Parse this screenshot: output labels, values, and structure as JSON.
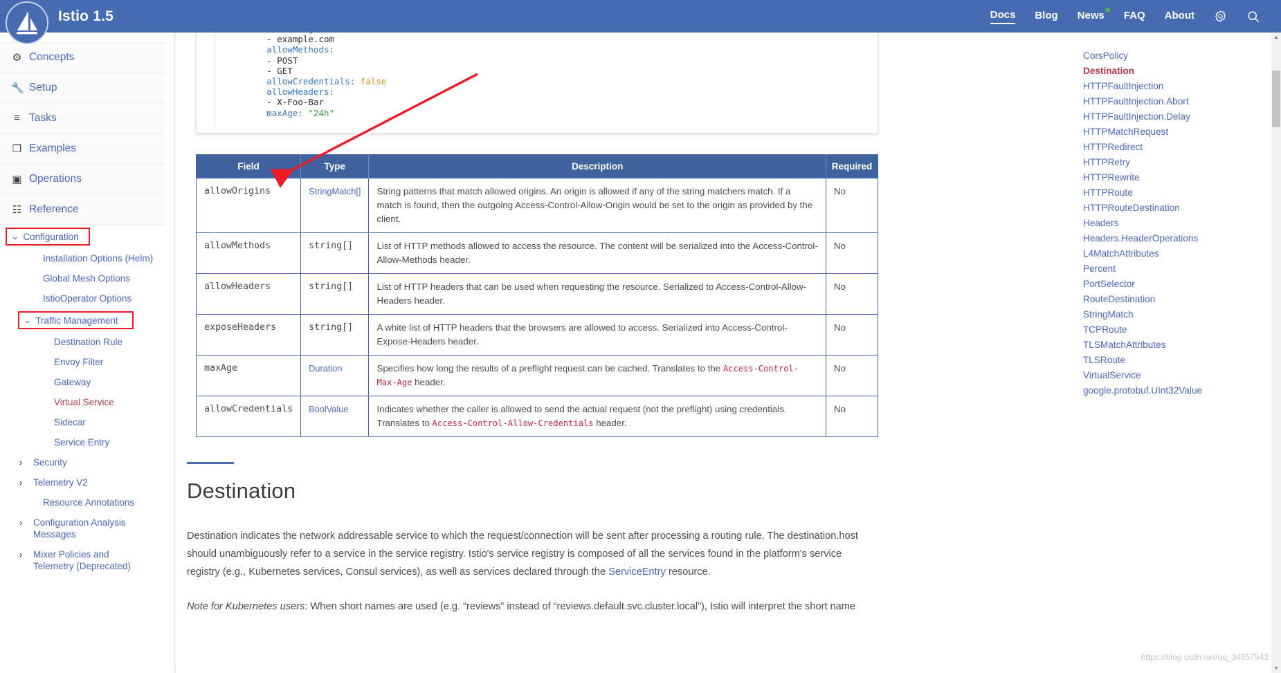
{
  "header": {
    "brand_title": "Istio 1.5",
    "logo_icon": "istio-sail-logo",
    "nav": [
      {
        "label": "Docs",
        "active": true,
        "dot": false
      },
      {
        "label": "Blog",
        "active": false,
        "dot": false
      },
      {
        "label": "News",
        "active": false,
        "dot": true
      },
      {
        "label": "FAQ",
        "active": false,
        "dot": false
      },
      {
        "label": "About",
        "active": false,
        "dot": false
      }
    ],
    "gear_icon": "gear-icon",
    "search_icon": "search-icon",
    "bg_color": "#466bb0"
  },
  "sidebar": {
    "major": [
      {
        "label": "Concepts",
        "icon": "lightbulb-icon"
      },
      {
        "label": "Setup",
        "icon": "wrench-icon"
      },
      {
        "label": "Tasks",
        "icon": "list-icon"
      },
      {
        "label": "Examples",
        "icon": "copy-icon"
      },
      {
        "label": "Operations",
        "icon": "clipboard-icon"
      },
      {
        "label": "Reference",
        "icon": "book-icon"
      }
    ],
    "configuration": {
      "label": "Configuration",
      "highlighted": true,
      "expanded": true
    },
    "config_children": [
      {
        "label": "Installation Options (Helm)"
      },
      {
        "label": "Global Mesh Options"
      },
      {
        "label": "IstioOperator Options"
      }
    ],
    "traffic_management": {
      "label": "Traffic Management",
      "highlighted": true,
      "expanded": true
    },
    "traffic_children": [
      {
        "label": "Destination Rule",
        "current": false
      },
      {
        "label": "Envoy Filter",
        "current": false
      },
      {
        "label": "Gateway",
        "current": false
      },
      {
        "label": "Virtual Service",
        "current": true
      },
      {
        "label": "Sidecar",
        "current": false
      },
      {
        "label": "Service Entry",
        "current": false
      }
    ],
    "collapsed_groups": [
      {
        "label": "Security"
      },
      {
        "label": "Telemetry V2"
      }
    ],
    "tail": [
      {
        "label": "Resource Annotations",
        "chevron": false
      },
      {
        "label": "Configuration Analysis Messages",
        "chevron": true
      },
      {
        "label": "Mixer Policies and Telemetry (Deprecated)",
        "chevron": true
      }
    ]
  },
  "code_block": {
    "lines": [
      {
        "segments": [
          {
            "t": "        allowOrigins:",
            "c": "tok-key"
          }
        ]
      },
      {
        "segments": [
          {
            "t": "        - example.com",
            "c": "tok-plain"
          }
        ]
      },
      {
        "segments": [
          {
            "t": "        allowMethods:",
            "c": "tok-key"
          }
        ]
      },
      {
        "segments": [
          {
            "t": "        - POST",
            "c": "tok-plain"
          }
        ]
      },
      {
        "segments": [
          {
            "t": "        - GET",
            "c": "tok-plain"
          }
        ]
      },
      {
        "segments": [
          {
            "t": "        allowCredentials: ",
            "c": "tok-key"
          },
          {
            "t": "false",
            "c": "tok-val"
          }
        ]
      },
      {
        "segments": [
          {
            "t": "        allowHeaders:",
            "c": "tok-key"
          }
        ]
      },
      {
        "segments": [
          {
            "t": "        - X-Foo-Bar",
            "c": "tok-plain"
          }
        ]
      },
      {
        "segments": [
          {
            "t": "        maxAge: ",
            "c": "tok-key"
          },
          {
            "t": "\"24h\"",
            "c": "tok-str"
          }
        ]
      }
    ]
  },
  "table": {
    "headers": [
      "Field",
      "Type",
      "Description",
      "Required"
    ],
    "rows": [
      {
        "field": "allowOrigins",
        "type": "StringMatch[]",
        "type_is_link": true,
        "description_html": "String patterns that match allowed origins. An origin is allowed if any of the string matchers match. If a match is found, then the outgoing Access-Control-Allow-Origin would be set to the origin as provided by the client.",
        "required": "No"
      },
      {
        "field": "allowMethods",
        "type": "string[]",
        "type_is_link": false,
        "description_html": "List of HTTP methods allowed to access the resource. The content will be serialized into the Access-Control-Allow-Methods header.",
        "required": "No"
      },
      {
        "field": "allowHeaders",
        "type": "string[]",
        "type_is_link": false,
        "description_html": "List of HTTP headers that can be used when requesting the resource. Serialized to Access-Control-Allow-Headers header.",
        "required": "No"
      },
      {
        "field": "exposeHeaders",
        "type": "string[]",
        "type_is_link": false,
        "description_html": "A white list of HTTP headers that the browsers are allowed to access. Serialized into Access-Control-Expose-Headers header.",
        "required": "No"
      },
      {
        "field": "maxAge",
        "type": "Duration",
        "type_is_link": true,
        "description_html": "Specifies how long the results of a preflight request can be cached. Translates to the <code class=\"inl\">Access-Control-Max-Age</code> header.",
        "required": "No"
      },
      {
        "field": "allowCredentials",
        "type": "BoolValue",
        "type_is_link": true,
        "description_html": "Indicates whether the caller is allowed to send the actual request (not the preflight) using credentials. Translates to <code class=\"inl\">Access-Control-Allow-Credentials</code> header.",
        "required": "No"
      }
    ]
  },
  "destination": {
    "title": "Destination",
    "paragraph1_before": "Destination indicates the network addressable service to which the request/connection will be sent after processing a routing rule. The destination.host should unambiguously refer to a service in the service registry. Istio's service registry is composed of all the services found in the platform's service registry (e.g., Kubernetes services, Consul services), as well as services declared through the ",
    "paragraph1_link": "ServiceEntry",
    "paragraph1_after": " resource.",
    "note_italic": "Note for Kubernetes users",
    "note_rest": ": When short names are used (e.g. “reviews” instead of “reviews.default.svc.cluster.local”), Istio will interpret the short name"
  },
  "toc": {
    "items": [
      {
        "label": "CorsPolicy",
        "current": false
      },
      {
        "label": "Destination",
        "current": true
      },
      {
        "label": "HTTPFaultInjection",
        "current": false
      },
      {
        "label": "HTTPFaultInjection.Abort",
        "current": false
      },
      {
        "label": "HTTPFaultInjection.Delay",
        "current": false
      },
      {
        "label": "HTTPMatchRequest",
        "current": false
      },
      {
        "label": "HTTPRedirect",
        "current": false
      },
      {
        "label": "HTTPRetry",
        "current": false
      },
      {
        "label": "HTTPRewrite",
        "current": false
      },
      {
        "label": "HTTPRoute",
        "current": false
      },
      {
        "label": "HTTPRouteDestination",
        "current": false
      },
      {
        "label": "Headers",
        "current": false
      },
      {
        "label": "Headers.HeaderOperations",
        "current": false
      },
      {
        "label": "L4MatchAttributes",
        "current": false
      },
      {
        "label": "Percent",
        "current": false
      },
      {
        "label": "PortSelector",
        "current": false
      },
      {
        "label": "RouteDestination",
        "current": false
      },
      {
        "label": "StringMatch",
        "current": false
      },
      {
        "label": "TCPRoute",
        "current": false
      },
      {
        "label": "TLSMatchAttributes",
        "current": false
      },
      {
        "label": "TLSRoute",
        "current": false
      },
      {
        "label": "VirtualService",
        "current": false
      },
      {
        "label": "google.protobuf.UInt32Value",
        "current": false
      }
    ]
  },
  "annotation": {
    "arrow_icon": "red-arrow-annotation",
    "arrow_color": "#ee1b24"
  },
  "watermark": "https://blog.csdn.net/qq_34657543"
}
